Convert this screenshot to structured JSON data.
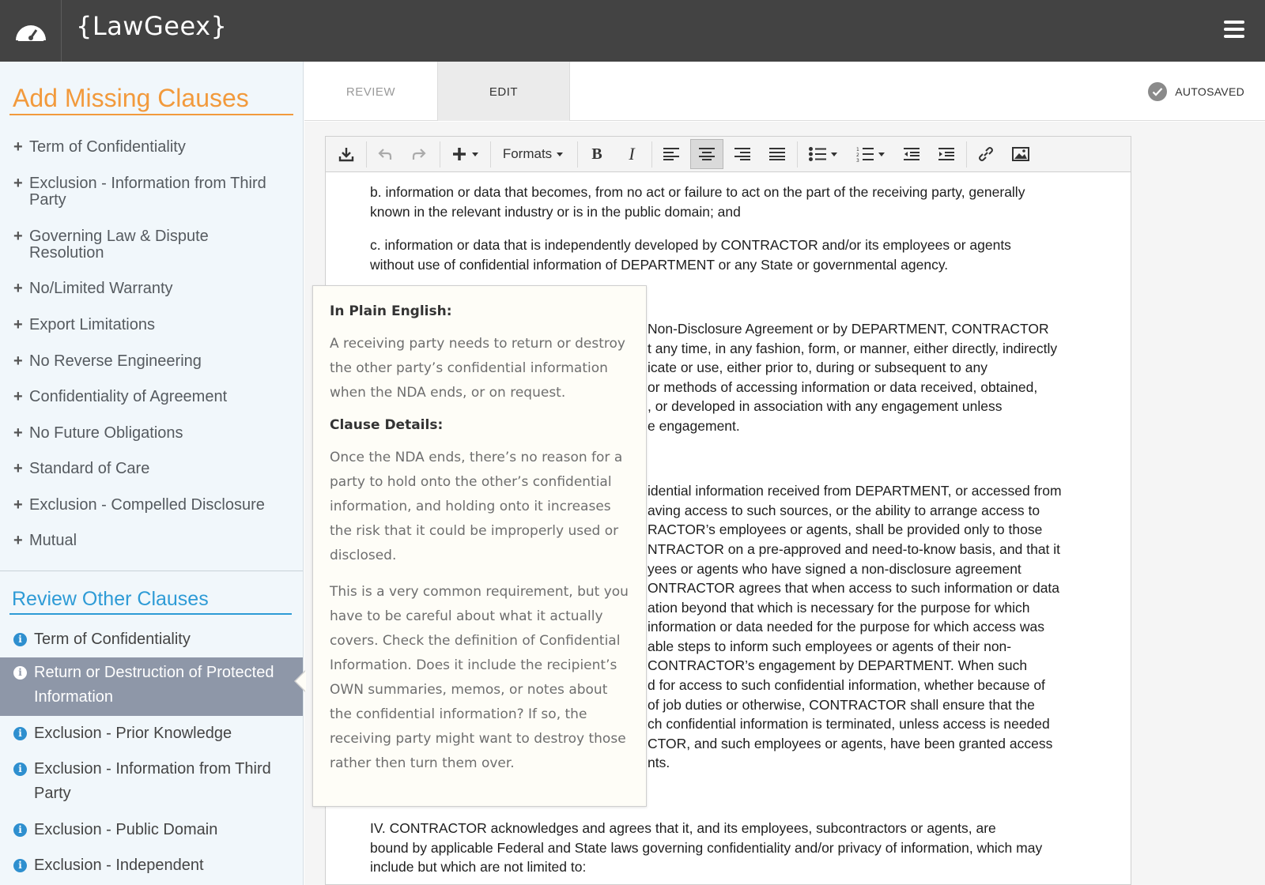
{
  "header": {
    "brand": "{LawGeex}",
    "logo_icon": "speedometer-cloud-icon",
    "menu_icon": "hamburger-menu-icon"
  },
  "sidebar": {
    "missing_title": "Add Missing Clauses",
    "missing_items": [
      {
        "label": "Term of Confidentiality"
      },
      {
        "label": "Exclusion - Information from Third Party"
      },
      {
        "label": "Governing Law & Dispute Resolution"
      },
      {
        "label": "No/Limited Warranty"
      },
      {
        "label": "Export Limitations"
      },
      {
        "label": "No Reverse Engineering"
      },
      {
        "label": "Confidentiality of Agreement"
      },
      {
        "label": "No Future Obligations"
      },
      {
        "label": "Standard of Care"
      },
      {
        "label": "Exclusion - Compelled Disclosure"
      },
      {
        "label": "Mutual"
      }
    ],
    "other_title": "Review Other Clauses",
    "other_items": [
      {
        "label": "Term of Confidentiality"
      },
      {
        "label": "Return or Destruction of Protected Information"
      },
      {
        "label": "Exclusion - Prior Knowledge"
      },
      {
        "label": "Exclusion - Information from Third Party"
      },
      {
        "label": "Exclusion - Public Domain"
      },
      {
        "label": "Exclusion - Independent"
      }
    ]
  },
  "tabs": {
    "review": "REVIEW",
    "edit": "EDIT",
    "autosaved": "AUTOSAVED"
  },
  "toolbar": {
    "formats": "Formats"
  },
  "document": {
    "b_lines": [
      "b.   information or data that becomes, from no act or failure to act on the part of the receiving party, generally",
      "known in the relevant industry or is in the public domain; and"
    ],
    "c_lines": [
      "c.  information or data that is independently developed by CONTRACTOR and/or its employees or agents",
      "without use of confidential information of DEPARTMENT or any State or governmental agency."
    ],
    "para2_lines": [
      "Non-Disclosure Agreement or by DEPARTMENT, CONTRACTOR",
      "t any time, in any fashion, form, or manner, either directly, indirectly",
      "icate or use, either prior to, during or subsequent to any",
      "or methods of accessing information or data received, obtained,",
      ", or developed in association with any engagement unless",
      "e engagement."
    ],
    "para3_lines": [
      "idential information received from DEPARTMENT, or accessed from",
      "aving access to such sources, or the ability to arrange access to",
      "RACTOR’s employees or agents, shall be provided only to those",
      "NTRACTOR on a pre-approved and need-to-know basis, and that it",
      "yees or agents who have signed a non-disclosure agreement",
      "ONTRACTOR agrees that when access to such information or data",
      "ation beyond that which is necessary for the purpose for which",
      " information or data needed for the purpose for which access was",
      "able steps to inform such employees or agents of their non-",
      "CONTRACTOR’s engagement by DEPARTMENT. When such",
      "d for access to such confidential information, whether because of",
      "of job duties or otherwise, CONTRACTOR shall ensure that the",
      "ch confidential information is terminated, unless access is needed",
      "CTOR, and such employees or agents, have been granted access",
      "nts."
    ],
    "iv_lines": [
      "IV.    CONTRACTOR acknowledges and agrees  that it, and its employees, subcontractors or agents, are",
      "bound by applicable Federal and State laws governing confidentiality and/or privacy of information, which may",
      "include but which are not limited to:"
    ]
  },
  "tooltip": {
    "plain_heading": "In Plain English:",
    "plain_text": "A receiving party needs to return or destroy the other party’s confidential information when the NDA ends, or on request.",
    "details_heading": "Clause Details:",
    "details_text_1": "Once the NDA ends, there’s no reason for a party to hold onto the other’s confidential information, and holding onto it increases the risk that it could be improperly used or disclosed.",
    "details_text_2": "This is a very common requirement, but you have to be careful about what it actually covers. Check the definition of Confidential Information. Does it include the recipient’s OWN summaries, memos, or notes about the confidential information? If so, the receiving party might want to destroy those rather then turn them over."
  },
  "colors": {
    "topbar": "#434343",
    "orange_accent": "#f29a3c",
    "blue_accent": "#2e9bd6",
    "active_item": "#8e97a8"
  }
}
